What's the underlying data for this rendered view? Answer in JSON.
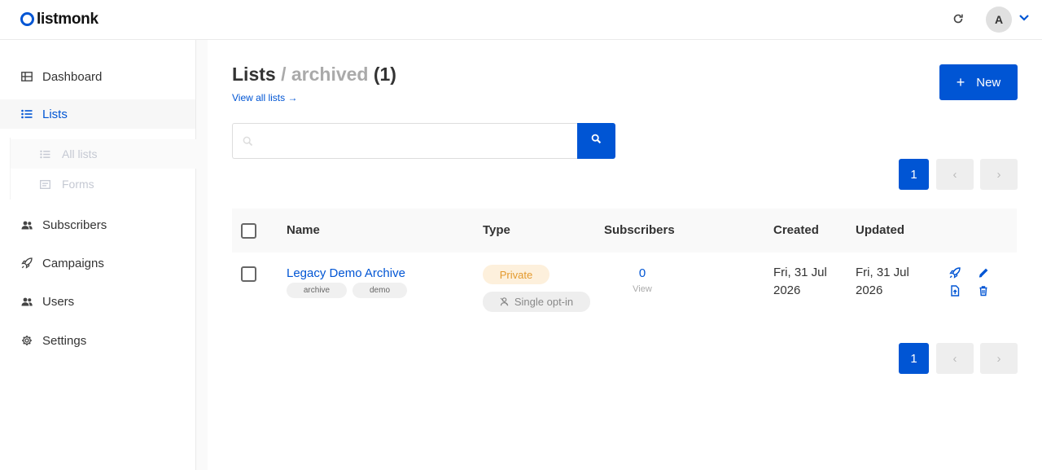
{
  "app": {
    "logo_text": "listmonk"
  },
  "header": {
    "avatar_initial": "A"
  },
  "sidebar": {
    "items": [
      {
        "label": "Dashboard",
        "icon": "dashboard-icon"
      },
      {
        "label": "Lists",
        "icon": "list-icon",
        "active": true
      },
      {
        "label": "Subscribers",
        "icon": "users-icon"
      },
      {
        "label": "Campaigns",
        "icon": "rocket-icon"
      },
      {
        "label": "Users",
        "icon": "users-icon"
      },
      {
        "label": "Settings",
        "icon": "gear-icon"
      }
    ],
    "subitems": [
      {
        "label": "All lists",
        "icon": "list-icon"
      },
      {
        "label": "Forms",
        "icon": "form-icon"
      }
    ]
  },
  "page": {
    "title": "Lists",
    "subtitle_sep": "/ archived",
    "count": "(1)",
    "view_all": "View all lists →",
    "new_button": "New",
    "new_plus": "+"
  },
  "search": {
    "placeholder": ""
  },
  "pagination": {
    "current": "1",
    "prev": "‹",
    "next": "›"
  },
  "table": {
    "headers": [
      "Name",
      "Type",
      "Subscribers",
      "Created",
      "Updated"
    ],
    "rows": [
      {
        "name": "Legacy Demo Archive",
        "tags": [
          "archive",
          "demo"
        ],
        "type": "Private",
        "optin": "Single opt-in",
        "subscribers": "0",
        "view_label": "View",
        "created_line1": "Fri, 31 Jul",
        "created_line2": "2026",
        "updated_line1": "Fri, 31 Jul",
        "updated_line2": "2026"
      }
    ]
  },
  "colors": {
    "accent": "#0055d4",
    "private_bg": "#fdf0dc",
    "private_text": "#e39a2e"
  }
}
